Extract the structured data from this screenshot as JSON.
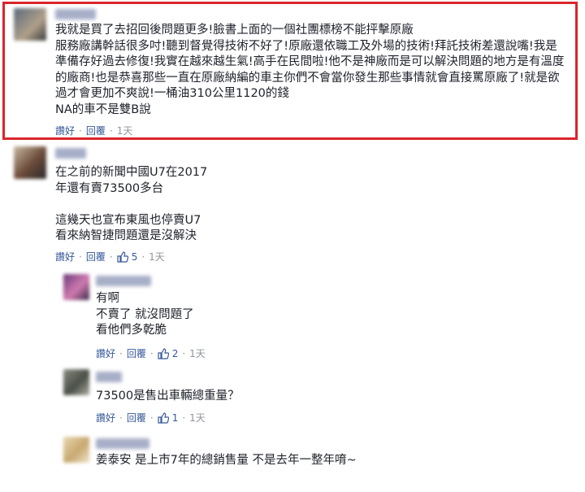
{
  "comments": [
    {
      "text": "我就是買了去招回後問題更多!臉書上面的一個社團標榜不能抨擊原廠\n服務廠講幹話很多吋!聽到督覺得技術不好了!原廠還依職工及外場的技術!拜託技術差還說嘴!我是準備存好過去修復!我實在越來越生氣!高手在民間啦!他不是神廠而是可以解決問題的地方是有溫度的廠商!也是恭喜那些一直在原廠納編的車主你們不會當你發生那些事情就會直接罵原廠了!就是欲過才會更加不爽說!一桶油310公里1120的錢\nNA的車不是雙B說",
      "like": "讚好",
      "reply": "回覆",
      "time": "1天"
    },
    {
      "text": "在之前的新聞中國U7在2017\n年還有賣73500多台\n\n這幾天也宣布東風也停賣U7\n看來納智捷問題還是沒解決",
      "like": "讚好",
      "reply": "回覆",
      "likes_count": "5",
      "time": "1天"
    },
    {
      "text": "有啊\n不賣了 就沒問題了\n看他們多乾脆",
      "like": "讚好",
      "reply": "回覆",
      "likes_count": "2",
      "time": "1天"
    },
    {
      "text": "73500是售出車輛總重量？",
      "like": "讚好",
      "reply": "回覆",
      "likes_count": "1",
      "time": "1天"
    },
    {
      "text": "姜泰安 是上市7年的總銷售量 不是去年一整年唷~"
    }
  ],
  "colors": {
    "highlight": "#d9262c",
    "link": "#365899",
    "muted": "#90949c"
  }
}
